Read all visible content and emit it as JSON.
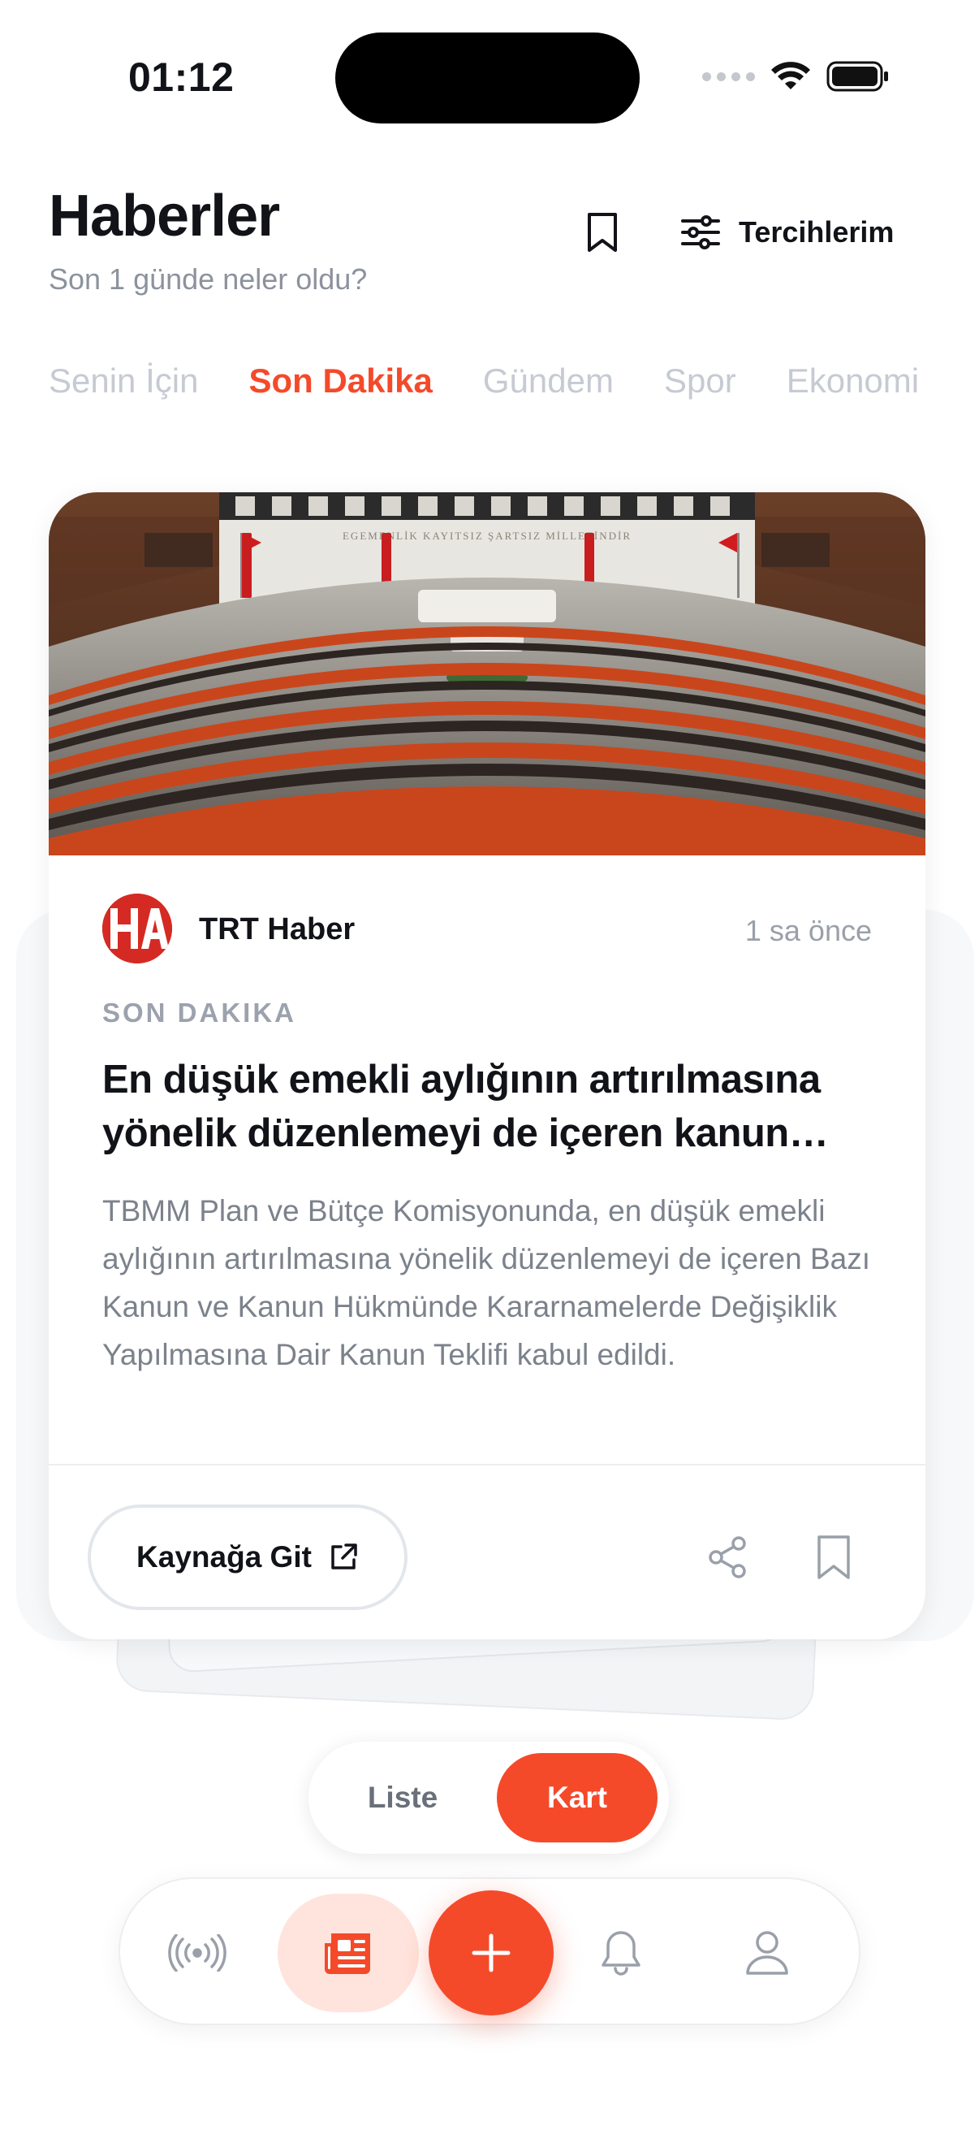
{
  "status_bar": {
    "time": "01:12"
  },
  "header": {
    "title": "Haberler",
    "subtitle": "Son 1 günde neler oldu?",
    "preferences_label": "Tercihlerim"
  },
  "tabs": [
    {
      "label": "Senin İçin",
      "active": false
    },
    {
      "label": "Son Dakika",
      "active": true
    },
    {
      "label": "Gündem",
      "active": false
    },
    {
      "label": "Spor",
      "active": false
    },
    {
      "label": "Ekonomi",
      "active": false
    }
  ],
  "card": {
    "source_name": "TRT Haber",
    "time_ago": "1 sa önce",
    "category": "SON DAKIKA",
    "headline": "En düşük emekli aylığının artırılmasına yönelik düzenlemeyi de içeren kanun teklifi",
    "summary": "TBMM Plan ve Bütçe Komisyonunda, en düşük emekli aylığının artırılmasına yönelik düzenlemeyi de içeren Bazı Kanun ve Kanun Hükmünde Kararnamelerde Değişiklik Yapılmasına Dair Kanun Teklifi kabul edildi.",
    "source_button_label": "Kaynağa Git",
    "image_banner_text": "EGEMENLİK KAYITSIZ ŞARTSIZ MİLLETİNDİR"
  },
  "view_toggle": {
    "list_label": "Liste",
    "card_label": "Kart",
    "selected": "Kart"
  },
  "bottom_nav": {
    "items": [
      "broadcast-icon",
      "newspaper-icon",
      "plus-icon",
      "bell-icon",
      "user-icon"
    ],
    "active": "newspaper-icon"
  },
  "colors": {
    "accent": "#f44a2a",
    "accent_soft": "#ffe4dd",
    "muted_text": "#8c929d",
    "inactive_tab": "#c6cad2",
    "source_logo": "#d52a23"
  }
}
